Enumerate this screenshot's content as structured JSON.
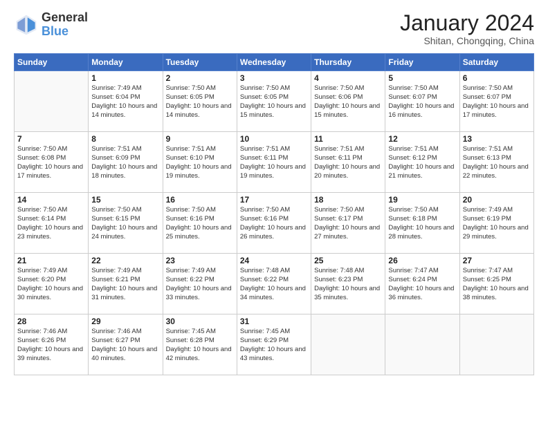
{
  "logo": {
    "general": "General",
    "blue": "Blue"
  },
  "title": "January 2024",
  "subtitle": "Shitan, Chongqing, China",
  "days_of_week": [
    "Sunday",
    "Monday",
    "Tuesday",
    "Wednesday",
    "Thursday",
    "Friday",
    "Saturday"
  ],
  "weeks": [
    [
      {
        "num": "",
        "sunrise": "",
        "sunset": "",
        "daylight": ""
      },
      {
        "num": "1",
        "sunrise": "Sunrise: 7:49 AM",
        "sunset": "Sunset: 6:04 PM",
        "daylight": "Daylight: 10 hours and 14 minutes."
      },
      {
        "num": "2",
        "sunrise": "Sunrise: 7:50 AM",
        "sunset": "Sunset: 6:05 PM",
        "daylight": "Daylight: 10 hours and 14 minutes."
      },
      {
        "num": "3",
        "sunrise": "Sunrise: 7:50 AM",
        "sunset": "Sunset: 6:05 PM",
        "daylight": "Daylight: 10 hours and 15 minutes."
      },
      {
        "num": "4",
        "sunrise": "Sunrise: 7:50 AM",
        "sunset": "Sunset: 6:06 PM",
        "daylight": "Daylight: 10 hours and 15 minutes."
      },
      {
        "num": "5",
        "sunrise": "Sunrise: 7:50 AM",
        "sunset": "Sunset: 6:07 PM",
        "daylight": "Daylight: 10 hours and 16 minutes."
      },
      {
        "num": "6",
        "sunrise": "Sunrise: 7:50 AM",
        "sunset": "Sunset: 6:07 PM",
        "daylight": "Daylight: 10 hours and 17 minutes."
      }
    ],
    [
      {
        "num": "7",
        "sunrise": "Sunrise: 7:50 AM",
        "sunset": "Sunset: 6:08 PM",
        "daylight": "Daylight: 10 hours and 17 minutes."
      },
      {
        "num": "8",
        "sunrise": "Sunrise: 7:51 AM",
        "sunset": "Sunset: 6:09 PM",
        "daylight": "Daylight: 10 hours and 18 minutes."
      },
      {
        "num": "9",
        "sunrise": "Sunrise: 7:51 AM",
        "sunset": "Sunset: 6:10 PM",
        "daylight": "Daylight: 10 hours and 19 minutes."
      },
      {
        "num": "10",
        "sunrise": "Sunrise: 7:51 AM",
        "sunset": "Sunset: 6:11 PM",
        "daylight": "Daylight: 10 hours and 19 minutes."
      },
      {
        "num": "11",
        "sunrise": "Sunrise: 7:51 AM",
        "sunset": "Sunset: 6:11 PM",
        "daylight": "Daylight: 10 hours and 20 minutes."
      },
      {
        "num": "12",
        "sunrise": "Sunrise: 7:51 AM",
        "sunset": "Sunset: 6:12 PM",
        "daylight": "Daylight: 10 hours and 21 minutes."
      },
      {
        "num": "13",
        "sunrise": "Sunrise: 7:51 AM",
        "sunset": "Sunset: 6:13 PM",
        "daylight": "Daylight: 10 hours and 22 minutes."
      }
    ],
    [
      {
        "num": "14",
        "sunrise": "Sunrise: 7:50 AM",
        "sunset": "Sunset: 6:14 PM",
        "daylight": "Daylight: 10 hours and 23 minutes."
      },
      {
        "num": "15",
        "sunrise": "Sunrise: 7:50 AM",
        "sunset": "Sunset: 6:15 PM",
        "daylight": "Daylight: 10 hours and 24 minutes."
      },
      {
        "num": "16",
        "sunrise": "Sunrise: 7:50 AM",
        "sunset": "Sunset: 6:16 PM",
        "daylight": "Daylight: 10 hours and 25 minutes."
      },
      {
        "num": "17",
        "sunrise": "Sunrise: 7:50 AM",
        "sunset": "Sunset: 6:16 PM",
        "daylight": "Daylight: 10 hours and 26 minutes."
      },
      {
        "num": "18",
        "sunrise": "Sunrise: 7:50 AM",
        "sunset": "Sunset: 6:17 PM",
        "daylight": "Daylight: 10 hours and 27 minutes."
      },
      {
        "num": "19",
        "sunrise": "Sunrise: 7:50 AM",
        "sunset": "Sunset: 6:18 PM",
        "daylight": "Daylight: 10 hours and 28 minutes."
      },
      {
        "num": "20",
        "sunrise": "Sunrise: 7:49 AM",
        "sunset": "Sunset: 6:19 PM",
        "daylight": "Daylight: 10 hours and 29 minutes."
      }
    ],
    [
      {
        "num": "21",
        "sunrise": "Sunrise: 7:49 AM",
        "sunset": "Sunset: 6:20 PM",
        "daylight": "Daylight: 10 hours and 30 minutes."
      },
      {
        "num": "22",
        "sunrise": "Sunrise: 7:49 AM",
        "sunset": "Sunset: 6:21 PM",
        "daylight": "Daylight: 10 hours and 31 minutes."
      },
      {
        "num": "23",
        "sunrise": "Sunrise: 7:49 AM",
        "sunset": "Sunset: 6:22 PM",
        "daylight": "Daylight: 10 hours and 33 minutes."
      },
      {
        "num": "24",
        "sunrise": "Sunrise: 7:48 AM",
        "sunset": "Sunset: 6:22 PM",
        "daylight": "Daylight: 10 hours and 34 minutes."
      },
      {
        "num": "25",
        "sunrise": "Sunrise: 7:48 AM",
        "sunset": "Sunset: 6:23 PM",
        "daylight": "Daylight: 10 hours and 35 minutes."
      },
      {
        "num": "26",
        "sunrise": "Sunrise: 7:47 AM",
        "sunset": "Sunset: 6:24 PM",
        "daylight": "Daylight: 10 hours and 36 minutes."
      },
      {
        "num": "27",
        "sunrise": "Sunrise: 7:47 AM",
        "sunset": "Sunset: 6:25 PM",
        "daylight": "Daylight: 10 hours and 38 minutes."
      }
    ],
    [
      {
        "num": "28",
        "sunrise": "Sunrise: 7:46 AM",
        "sunset": "Sunset: 6:26 PM",
        "daylight": "Daylight: 10 hours and 39 minutes."
      },
      {
        "num": "29",
        "sunrise": "Sunrise: 7:46 AM",
        "sunset": "Sunset: 6:27 PM",
        "daylight": "Daylight: 10 hours and 40 minutes."
      },
      {
        "num": "30",
        "sunrise": "Sunrise: 7:45 AM",
        "sunset": "Sunset: 6:28 PM",
        "daylight": "Daylight: 10 hours and 42 minutes."
      },
      {
        "num": "31",
        "sunrise": "Sunrise: 7:45 AM",
        "sunset": "Sunset: 6:29 PM",
        "daylight": "Daylight: 10 hours and 43 minutes."
      },
      {
        "num": "",
        "sunrise": "",
        "sunset": "",
        "daylight": ""
      },
      {
        "num": "",
        "sunrise": "",
        "sunset": "",
        "daylight": ""
      },
      {
        "num": "",
        "sunrise": "",
        "sunset": "",
        "daylight": ""
      }
    ]
  ]
}
